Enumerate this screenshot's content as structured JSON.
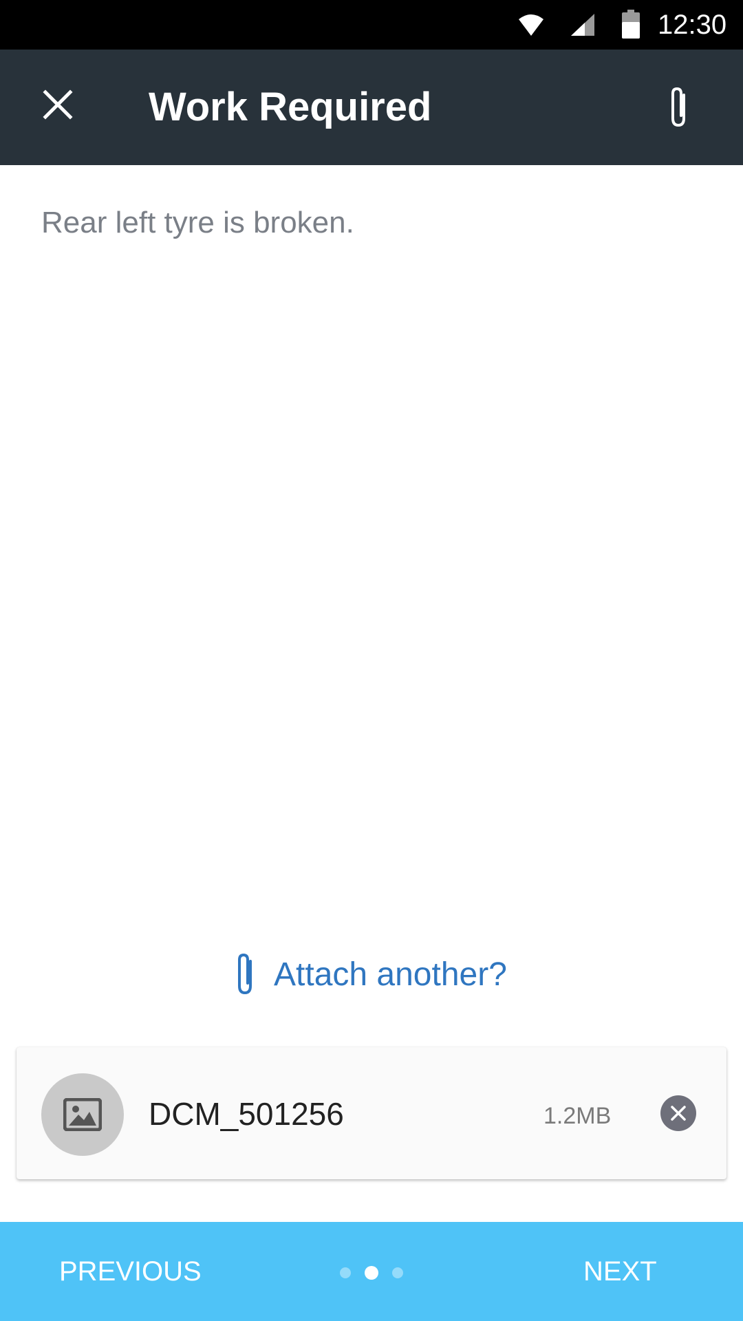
{
  "status_bar": {
    "time": "12:30",
    "icons": [
      "wifi-icon",
      "cell-signal-icon",
      "battery-icon"
    ]
  },
  "app_bar": {
    "title": "Work Required",
    "close_icon": "close-icon",
    "attach_icon": "paperclip-icon"
  },
  "content": {
    "description": "Rear left tyre is broken.",
    "attach_another_label": "Attach another?"
  },
  "attachment": {
    "file_name": "DCM_501256",
    "file_size": "1.2MB",
    "thumb_icon": "image-icon",
    "remove_icon": "remove-icon"
  },
  "footer": {
    "previous_label": "PREVIOUS",
    "next_label": "NEXT",
    "page_count": 3,
    "current_page": 2
  },
  "colors": {
    "status_bar": "#000000",
    "app_bar": "#28323a",
    "accent": "#2f76c0",
    "bottom_bar": "#4fc3f7",
    "description_text": "#7a7f87"
  }
}
